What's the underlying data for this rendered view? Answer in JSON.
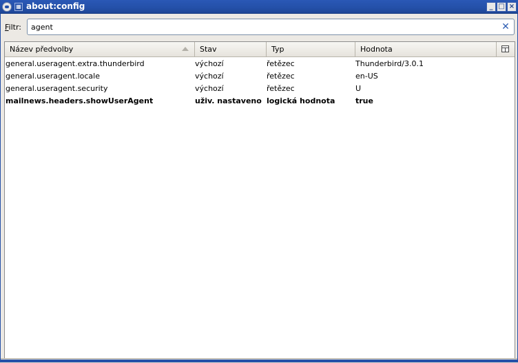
{
  "window": {
    "title": "about:config",
    "minimize_icon": "minimize-icon",
    "maximize_icon": "maximize-icon",
    "close_icon": "close-icon"
  },
  "filter": {
    "label_accel": "F",
    "label_rest": "iltr:",
    "value": "agent",
    "clear_icon": "clear-icon"
  },
  "table": {
    "columns": [
      "Název předvolby",
      "Stav",
      "Typ",
      "Hodnota"
    ],
    "sort_column": "Název předvolby",
    "sort_direction": "ascending",
    "rows": [
      {
        "name": "general.useragent.extra.thunderbird",
        "status": "výchozí",
        "type": "řetězec",
        "value": "Thunderbird/3.0.1",
        "modified": false
      },
      {
        "name": "general.useragent.locale",
        "status": "výchozí",
        "type": "řetězec",
        "value": "en-US",
        "modified": false
      },
      {
        "name": "general.useragent.security",
        "status": "výchozí",
        "type": "řetězec",
        "value": "U",
        "modified": false
      },
      {
        "name": "mailnews.headers.showUserAgent",
        "status": "uživ. nastaveno",
        "type": "logická hodnota",
        "value": "true",
        "modified": true
      }
    ]
  },
  "colors": {
    "titlebar": "#2450a8",
    "window_bg": "#ece9e4",
    "clear_icon": "#2f5fb3"
  }
}
